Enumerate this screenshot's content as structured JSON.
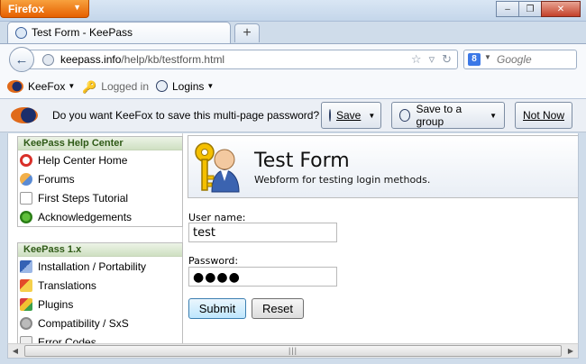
{
  "window": {
    "app_button": "Firefox",
    "controls": {
      "minimize": "‒",
      "maximize": "❐",
      "close": "✕"
    }
  },
  "tabs": [
    {
      "title": "Test Form - KeePass"
    }
  ],
  "new_tab_label": "+",
  "navbar": {
    "url_host": "keepass.info",
    "url_path": "/help/kb/testform.html",
    "search_placeholder": "Google",
    "search_engine_icon": "8"
  },
  "keefox_toolbar": {
    "keefox_label": "KeeFox",
    "status_label": "Logged in",
    "logins_label": "Logins"
  },
  "notification": {
    "message": "Do you want KeeFox to save this multi-page password?",
    "save_label": "Save",
    "save_group_label": "Save to a group",
    "not_now_label": "Not Now"
  },
  "sidebar": {
    "sections": [
      {
        "title": "KeePass Help Center",
        "items": [
          {
            "label": "Help Center Home",
            "icon": "lifebuoy-icon"
          },
          {
            "label": "Forums",
            "icon": "users-icon"
          },
          {
            "label": "First Steps Tutorial",
            "icon": "document-icon"
          },
          {
            "label": "Acknowledgements",
            "icon": "award-icon"
          }
        ]
      },
      {
        "title": "KeePass 1.x",
        "items": [
          {
            "label": "Installation / Portability",
            "icon": "install-icon"
          },
          {
            "label": "Translations",
            "icon": "translations-icon"
          },
          {
            "label": "Plugins",
            "icon": "plugins-icon"
          },
          {
            "label": "Compatibility / SxS",
            "icon": "compatibility-icon"
          },
          {
            "label": "Error Codes",
            "icon": "error-codes-icon"
          }
        ]
      }
    ]
  },
  "page": {
    "title": "Test Form",
    "subtitle": "Webform for testing login methods.",
    "username_label": "User name:",
    "username_value": "test",
    "password_label": "Password:",
    "password_value": "●●●●",
    "submit_label": "Submit",
    "reset_label": "Reset"
  },
  "scrollbar": {
    "grip": "|||"
  }
}
